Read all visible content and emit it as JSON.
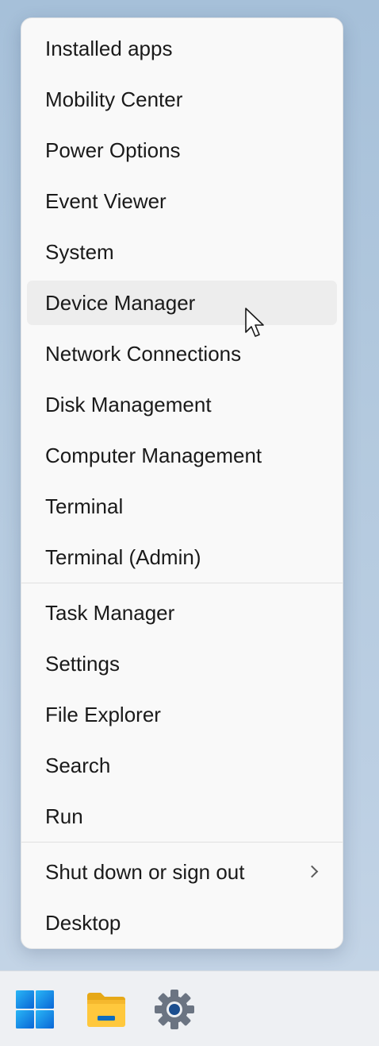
{
  "context_menu": {
    "items": [
      {
        "label": "Installed apps",
        "name": "menu-item-installed-apps"
      },
      {
        "label": "Mobility Center",
        "name": "menu-item-mobility-center"
      },
      {
        "label": "Power Options",
        "name": "menu-item-power-options"
      },
      {
        "label": "Event Viewer",
        "name": "menu-item-event-viewer"
      },
      {
        "label": "System",
        "name": "menu-item-system"
      },
      {
        "label": "Device Manager",
        "name": "menu-item-device-manager",
        "hovered": true
      },
      {
        "label": "Network Connections",
        "name": "menu-item-network-connections"
      },
      {
        "label": "Disk Management",
        "name": "menu-item-disk-management"
      },
      {
        "label": "Computer Management",
        "name": "menu-item-computer-management"
      },
      {
        "label": "Terminal",
        "name": "menu-item-terminal"
      },
      {
        "label": "Terminal (Admin)",
        "name": "menu-item-terminal-admin"
      },
      {
        "label": "Task Manager",
        "name": "menu-item-task-manager"
      },
      {
        "label": "Settings",
        "name": "menu-item-settings"
      },
      {
        "label": "File Explorer",
        "name": "menu-item-file-explorer"
      },
      {
        "label": "Search",
        "name": "menu-item-search"
      },
      {
        "label": "Run",
        "name": "menu-item-run"
      },
      {
        "label": "Shut down or sign out",
        "name": "menu-item-shut-down-or-sign-out",
        "has_submenu": true
      },
      {
        "label": "Desktop",
        "name": "menu-item-desktop"
      }
    ]
  },
  "taskbar": {
    "icons": [
      {
        "name": "start-button",
        "icon": "windows-logo-icon"
      },
      {
        "name": "file-explorer-button",
        "icon": "folder-icon"
      },
      {
        "name": "settings-button",
        "icon": "gear-icon"
      }
    ]
  },
  "colors": {
    "accent": "#0078d4",
    "menu_background": "#f9f9f9",
    "hover_background": "#ededed"
  }
}
